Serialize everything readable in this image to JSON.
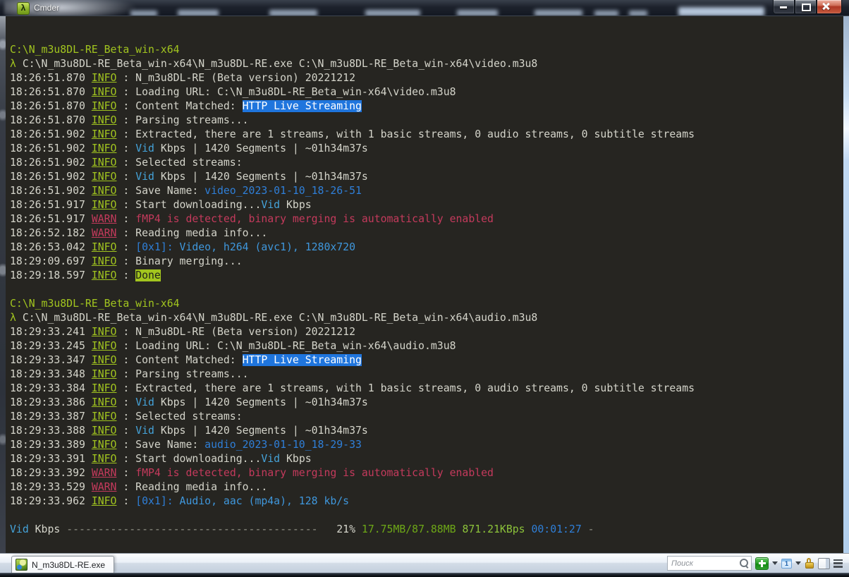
{
  "window": {
    "title": "Cmder",
    "icon_glyph": "λ",
    "buttons": {
      "minimize": "minimize",
      "maximize": "maximize",
      "close": "close"
    }
  },
  "palette": {
    "terminal_bg": "#262521",
    "terminal_fg": "#d4d4ca",
    "prompt_green": "#a1c41f",
    "warn_red": "#c43a5c",
    "stream_cyan": "#45a3d9",
    "link_blue": "#2f7fd8",
    "match_highlight_bg": "#1f75dd",
    "done_highlight_bg": "#a3c51e",
    "size_green": "#6da717",
    "speed_green": "#8cc23a",
    "dash_gray": "#8e8e84"
  },
  "terminal": {
    "lines": [
      [
        [
          "C:\\N_m3u8DL-RE_Beta_win-x64",
          "grn"
        ]
      ],
      [
        [
          "λ",
          "grn"
        ],
        [
          " C:\\N_m3u8DL-RE_Beta_win-x64\\N_m3u8DL-RE.exe C:\\N_m3u8DL-RE_Beta_win-x64\\video.m3u8",
          "fg"
        ]
      ],
      [
        [
          "18:26:51.870 ",
          "fg"
        ],
        [
          "INFO",
          "info"
        ],
        [
          " : N_m3u8DL-RE (Beta version) 20221212",
          "fg"
        ]
      ],
      [
        [
          "18:26:51.870 ",
          "fg"
        ],
        [
          "INFO",
          "info"
        ],
        [
          " : Loading URL: C:\\N_m3u8DL-RE_Beta_win-x64\\video.m3u8",
          "fg"
        ]
      ],
      [
        [
          "18:26:51.870 ",
          "fg"
        ],
        [
          "INFO",
          "info"
        ],
        [
          " : Content Matched: ",
          "fg"
        ],
        [
          "HTTP Live Streaming",
          "hlb"
        ]
      ],
      [
        [
          "18:26:51.870 ",
          "fg"
        ],
        [
          "INFO",
          "info"
        ],
        [
          " : Parsing streams...",
          "fg"
        ]
      ],
      [
        [
          "18:26:51.902 ",
          "fg"
        ],
        [
          "INFO",
          "info"
        ],
        [
          " : Extracted, there are 1 streams, with 1 basic streams, 0 audio streams, 0 subtitle streams",
          "fg"
        ]
      ],
      [
        [
          "18:26:51.902 ",
          "fg"
        ],
        [
          "INFO",
          "info"
        ],
        [
          " : ",
          "fg"
        ],
        [
          "Vid",
          "cyn"
        ],
        [
          " Kbps | 1420 Segments | ~01h34m37s",
          "fg"
        ]
      ],
      [
        [
          "18:26:51.902 ",
          "fg"
        ],
        [
          "INFO",
          "info"
        ],
        [
          " : Selected streams:",
          "fg"
        ]
      ],
      [
        [
          "18:26:51.902 ",
          "fg"
        ],
        [
          "INFO",
          "info"
        ],
        [
          " : ",
          "fg"
        ],
        [
          "Vid",
          "cyn"
        ],
        [
          " Kbps | 1420 Segments | ~01h34m37s",
          "fg"
        ]
      ],
      [
        [
          "18:26:51.902 ",
          "fg"
        ],
        [
          "INFO",
          "info"
        ],
        [
          " : Save Name: ",
          "fg"
        ],
        [
          "video_2023-01-10_18-26-51",
          "blu"
        ]
      ],
      [
        [
          "18:26:51.917 ",
          "fg"
        ],
        [
          "INFO",
          "info"
        ],
        [
          " : Start downloading...",
          "fg"
        ],
        [
          "Vid",
          "cyn"
        ],
        [
          " Kbps",
          "fg"
        ]
      ],
      [
        [
          "18:26:51.917 ",
          "fg"
        ],
        [
          "WARN",
          "wrn"
        ],
        [
          " : ",
          "fg"
        ],
        [
          "fMP4 is detected, binary merging is automatically enabled",
          "wrnmsg"
        ]
      ],
      [
        [
          "18:26:52.182 ",
          "fg"
        ],
        [
          "WARN",
          "wrn"
        ],
        [
          " : Reading media info...",
          "fg"
        ]
      ],
      [
        [
          "18:26:53.042 ",
          "fg"
        ],
        [
          "INFO",
          "info"
        ],
        [
          " : ",
          "fg"
        ],
        [
          "[0x1]: ",
          "blu"
        ],
        [
          "Video, h264 (avc1), 1280x720",
          "blu2"
        ]
      ],
      [
        [
          "18:29:09.697 ",
          "fg"
        ],
        [
          "INFO",
          "info"
        ],
        [
          " : Binary merging...",
          "fg"
        ]
      ],
      [
        [
          "18:29:18.597 ",
          "fg"
        ],
        [
          "INFO",
          "info"
        ],
        [
          " : ",
          "fg"
        ],
        [
          "Done",
          "hlg"
        ]
      ],
      [],
      [
        [
          "C:\\N_m3u8DL-RE_Beta_win-x64",
          "grn"
        ]
      ],
      [
        [
          "λ",
          "grn"
        ],
        [
          " C:\\N_m3u8DL-RE_Beta_win-x64\\N_m3u8DL-RE.exe C:\\N_m3u8DL-RE_Beta_win-x64\\audio.m3u8",
          "fg"
        ]
      ],
      [
        [
          "18:29:33.241 ",
          "fg"
        ],
        [
          "INFO",
          "info"
        ],
        [
          " : N_m3u8DL-RE (Beta version) 20221212",
          "fg"
        ]
      ],
      [
        [
          "18:29:33.245 ",
          "fg"
        ],
        [
          "INFO",
          "info"
        ],
        [
          " : Loading URL: C:\\N_m3u8DL-RE_Beta_win-x64\\audio.m3u8",
          "fg"
        ]
      ],
      [
        [
          "18:29:33.347 ",
          "fg"
        ],
        [
          "INFO",
          "info"
        ],
        [
          " : Content Matched: ",
          "fg"
        ],
        [
          "HTTP Live Streaming",
          "hlb"
        ]
      ],
      [
        [
          "18:29:33.348 ",
          "fg"
        ],
        [
          "INFO",
          "info"
        ],
        [
          " : Parsing streams...",
          "fg"
        ]
      ],
      [
        [
          "18:29:33.384 ",
          "fg"
        ],
        [
          "INFO",
          "info"
        ],
        [
          " : Extracted, there are 1 streams, with 1 basic streams, 0 audio streams, 0 subtitle streams",
          "fg"
        ]
      ],
      [
        [
          "18:29:33.386 ",
          "fg"
        ],
        [
          "INFO",
          "info"
        ],
        [
          " : ",
          "fg"
        ],
        [
          "Vid",
          "cyn"
        ],
        [
          " Kbps | 1420 Segments | ~01h34m37s",
          "fg"
        ]
      ],
      [
        [
          "18:29:33.387 ",
          "fg"
        ],
        [
          "INFO",
          "info"
        ],
        [
          " : Selected streams:",
          "fg"
        ]
      ],
      [
        [
          "18:29:33.388 ",
          "fg"
        ],
        [
          "INFO",
          "info"
        ],
        [
          " : ",
          "fg"
        ],
        [
          "Vid",
          "cyn"
        ],
        [
          " Kbps | 1420 Segments | ~01h34m37s",
          "fg"
        ]
      ],
      [
        [
          "18:29:33.389 ",
          "fg"
        ],
        [
          "INFO",
          "info"
        ],
        [
          " : Save Name: ",
          "fg"
        ],
        [
          "audio_2023-01-10_18-29-33",
          "blu"
        ]
      ],
      [
        [
          "18:29:33.391 ",
          "fg"
        ],
        [
          "INFO",
          "info"
        ],
        [
          " : Start downloading...",
          "fg"
        ],
        [
          "Vid",
          "cyn"
        ],
        [
          " Kbps",
          "fg"
        ]
      ],
      [
        [
          "18:29:33.392 ",
          "fg"
        ],
        [
          "WARN",
          "wrn"
        ],
        [
          " : ",
          "fg"
        ],
        [
          "fMP4 is detected, binary merging is automatically enabled",
          "wrnmsg"
        ]
      ],
      [
        [
          "18:29:33.529 ",
          "fg"
        ],
        [
          "WARN",
          "wrn"
        ],
        [
          " : Reading media info...",
          "fg"
        ]
      ],
      [
        [
          "18:29:33.962 ",
          "fg"
        ],
        [
          "INFO",
          "info"
        ],
        [
          " : ",
          "fg"
        ],
        [
          "[0x1]: ",
          "blu"
        ],
        [
          "Audio, aac (mp4a), 128 kb/s",
          "blu2"
        ]
      ],
      [],
      [
        [
          "Vid",
          "cyn"
        ],
        [
          " Kbps ",
          "fg"
        ],
        [
          "----------------------------------------",
          "gry"
        ],
        [
          "   ",
          "fg"
        ],
        [
          "21% ",
          "fg"
        ],
        [
          "17.75MB/87.88MB",
          "grn2"
        ],
        [
          " ",
          "fg"
        ],
        [
          "871.21KBps",
          "grn3"
        ],
        [
          " ",
          "fg"
        ],
        [
          "00:01:27",
          "blu"
        ],
        [
          " -",
          "gry"
        ]
      ]
    ]
  },
  "statusbar": {
    "tab_label": "N_m3u8DL-RE.exe",
    "search_placeholder": "Поиск",
    "console_number": "1",
    "icons": [
      "search-icon",
      "new-console-icon",
      "dropdown-icon",
      "active-console-icon",
      "dropdown-icon",
      "lock-icon",
      "view-toggle-icon",
      "menu-icon"
    ]
  }
}
